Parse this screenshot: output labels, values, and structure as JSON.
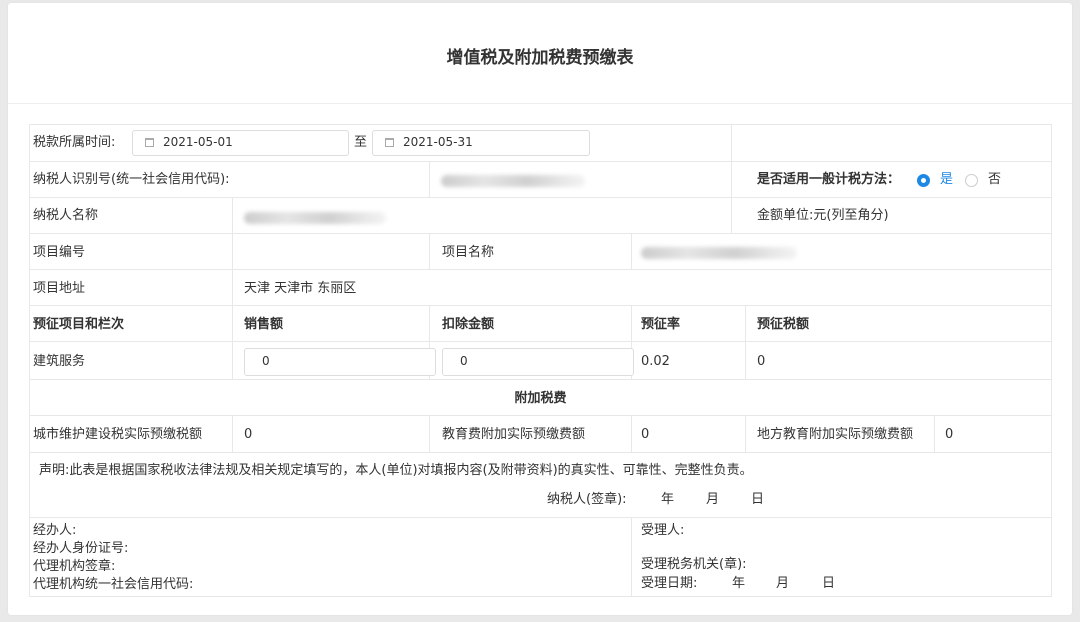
{
  "title": "增值税及附加税费预缴表",
  "period": {
    "label": "税款所属时间:",
    "start": "2021-05-01",
    "to": "至",
    "end": "2021-05-31"
  },
  "taxpayer_id_label": "纳税人识别号(统一社会信用代码):",
  "general_method": {
    "label": "是否适用一般计税方法：",
    "yes": "是",
    "no": "否",
    "selected": "是"
  },
  "taxpayer_name_label": "纳税人名称",
  "amount_unit": "金额单位:元(列至角分)",
  "project_no_label": "项目编号",
  "project_name_label": "项目名称",
  "project_address_label": "项目地址",
  "project_address": "天津 天津市 东丽区",
  "prepay_headers": [
    "预征项目和栏次",
    "销售额",
    "扣除金额",
    "预征率",
    "预征税额"
  ],
  "prepay_row": {
    "item": "建筑服务",
    "sales": "0",
    "deduction": "0",
    "rate": "0.02",
    "tax": "0"
  },
  "surcharge": {
    "heading": "附加税费",
    "urban_label": "城市维护建设税实际预缴税额",
    "urban_value": "0",
    "edu_label": "教育费附加实际预缴费额",
    "edu_value": "0",
    "local_edu_label": "地方教育附加实际预缴费额",
    "local_edu_value": "0"
  },
  "declaration": {
    "text": "声明:此表是根据国家税收法律法规及相关规定填写的，本人(单位)对填报内容(及附带资料)的真实性、可靠性、完整性负责。",
    "sign_label": "纳税人(签章):",
    "year": "年",
    "month": "月",
    "day": "日"
  },
  "agent": {
    "handler": "经办人:",
    "handler_id": "经办人身份证号:",
    "agency_seal": "代理机构签章:",
    "agency_code": "代理机构统一社会信用代码:"
  },
  "receiver": {
    "receiver": "受理人:",
    "office": "受理税务机关(章):",
    "date_label": "受理日期:",
    "year": "年",
    "month": "月",
    "day": "日"
  }
}
